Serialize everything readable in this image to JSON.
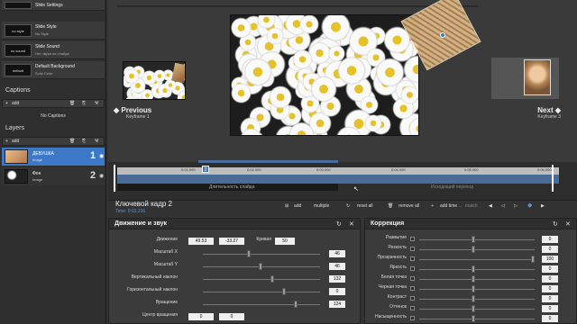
{
  "slides": [
    {
      "thumb": "",
      "title": "Slide Settings",
      "sub": ""
    },
    {
      "thumb": "no style",
      "title": "Slide Style",
      "sub": "No Style"
    },
    {
      "thumb": "no sound",
      "title": "Slide Sound",
      "sub": "Нет звука на слайде"
    },
    {
      "thumb": "default",
      "title": "Default Background",
      "sub": "Solid Color"
    }
  ],
  "captions": {
    "title": "Captions",
    "add": "add",
    "empty": "No Captions"
  },
  "layers": {
    "title": "Layers",
    "add": "add",
    "items": [
      {
        "name": "ДЕВУШКА",
        "type": "Image",
        "num": "1"
      },
      {
        "name": "Фон",
        "type": "Image",
        "num": "2"
      }
    ]
  },
  "nav": {
    "prev": {
      "title": "Previous",
      "sub": "Keyframe 1"
    },
    "next": {
      "title": "Next",
      "sub": "Keyframe 3"
    }
  },
  "timeline": {
    "ticks": [
      "0:01.000",
      "0:02.000",
      "0:03.000",
      "0:04.000",
      "0:05.000",
      "0:06.000"
    ],
    "marker": "2",
    "bar_label": "Ключевой кадр 2",
    "dark_label": "Длительность слайда",
    "end_label": "Исходящий переход"
  },
  "keyframe": {
    "title": "Ключевой кадр 2",
    "time": "Time: 0:01.216",
    "buttons": {
      "add": "add",
      "multiple": "multiple",
      "reset": "reset all",
      "remove": "remove all",
      "addtime": "add time",
      "match": "match"
    }
  },
  "motion": {
    "title": "Движение и звук",
    "rows": [
      {
        "label": "Движение",
        "v1": "49.53",
        "v2": "-33.27",
        "extra_label": "Кривая",
        "extra": "50"
      },
      {
        "label": "Масштаб X",
        "value": "46"
      },
      {
        "label": "Масштаб Y",
        "value": "46"
      },
      {
        "label": "Вертикальный наклон",
        "value": "132"
      },
      {
        "label": "Горизонтальный наклон",
        "value": "0"
      },
      {
        "label": "Вращение",
        "value": "124"
      },
      {
        "label": "Центр вращения",
        "v1": "0",
        "v2": "0"
      }
    ]
  },
  "correction": {
    "title": "Коррекция",
    "rows": [
      {
        "label": "Размытие",
        "value": "0"
      },
      {
        "label": "Резкость",
        "value": "0"
      },
      {
        "label": "Прозрачность",
        "value": "100"
      },
      {
        "label": "Яркость",
        "value": "0"
      },
      {
        "label": "Белая точка",
        "value": "0"
      },
      {
        "label": "Черная точка",
        "value": "0"
      },
      {
        "label": "Контраст",
        "value": "0"
      },
      {
        "label": "Оттенок",
        "value": "0"
      },
      {
        "label": "Насыщенность",
        "value": "0"
      }
    ]
  },
  "colors": {
    "accent": "#4a6c98",
    "selected": "#3d78c8",
    "bg": "#333333"
  }
}
